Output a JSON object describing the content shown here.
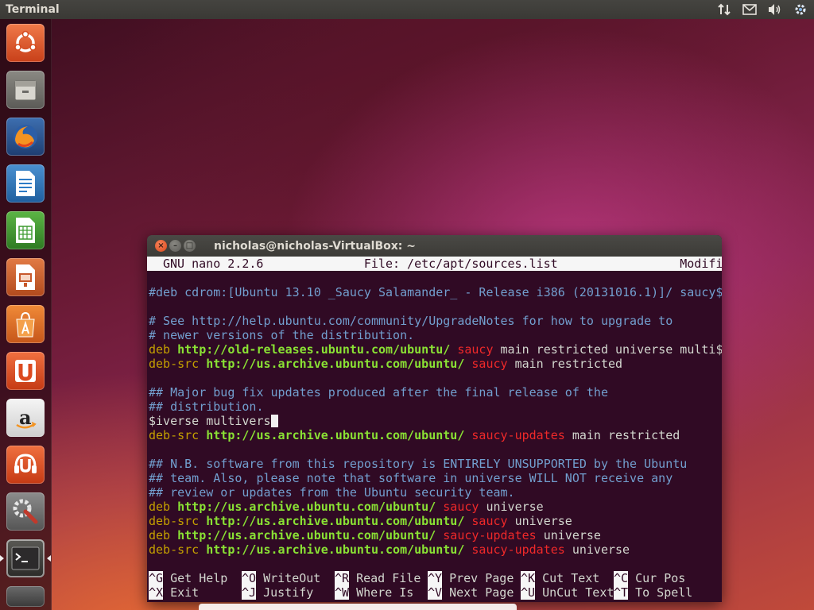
{
  "top_panel": {
    "title": "Terminal"
  },
  "launcher": {
    "items": [
      {
        "name": "ubuntu-dash-icon",
        "color": "#e8542a"
      },
      {
        "name": "files-icon",
        "color": "#a8a79f"
      },
      {
        "name": "firefox-icon",
        "color": "#2b5ea7"
      },
      {
        "name": "writer-icon",
        "color": "#2d7bc6"
      },
      {
        "name": "calc-icon",
        "color": "#3c9a2e"
      },
      {
        "name": "impress-icon",
        "color": "#c7582b"
      },
      {
        "name": "software-center-icon",
        "color": "#e07a2a"
      },
      {
        "name": "ubuntu-one-icon",
        "color": "#dc4a1f"
      },
      {
        "name": "amazon-icon",
        "color": "#e8e8e8"
      },
      {
        "name": "ubuntu-one-music-icon",
        "color": "#dc4a1f"
      },
      {
        "name": "system-settings-icon",
        "color": "#7a7a7a"
      },
      {
        "name": "terminal-icon",
        "color": "#3c3b37"
      }
    ]
  },
  "window": {
    "title": "nicholas@nicholas-VirtualBox: ~"
  },
  "nano": {
    "version": "GNU nano 2.2.6",
    "file": "File: /etc/apt/sources.list",
    "status": "Modified",
    "lines": [
      [
        {
          "t": "",
          "c": "plain"
        }
      ],
      [
        {
          "t": "#deb cdrom:[Ubuntu 13.10 _Saucy Salamander_ - Release i386 (20131016.1)]/ saucy$",
          "c": "com"
        }
      ],
      [
        {
          "t": "",
          "c": "plain"
        }
      ],
      [
        {
          "t": "# See http://help.ubuntu.com/community/UpgradeNotes for how to upgrade to",
          "c": "com"
        }
      ],
      [
        {
          "t": "# newer versions of the distribution.",
          "c": "com"
        }
      ],
      [
        {
          "t": "deb ",
          "c": "deb"
        },
        {
          "t": "http://old-releases.ubuntu.com/ubuntu/",
          "c": "url"
        },
        {
          "t": " saucy",
          "c": "red"
        },
        {
          "t": " main restricted universe multi$",
          "c": "rest"
        }
      ],
      [
        {
          "t": "deb-src ",
          "c": "deb"
        },
        {
          "t": "http://us.archive.ubuntu.com/ubuntu/",
          "c": "url"
        },
        {
          "t": " saucy",
          "c": "red"
        },
        {
          "t": " main restricted",
          "c": "rest"
        }
      ],
      [
        {
          "t": "",
          "c": "plain"
        }
      ],
      [
        {
          "t": "## Major bug fix updates produced after the final release of the",
          "c": "com"
        }
      ],
      [
        {
          "t": "## distribution.",
          "c": "com"
        }
      ],
      [
        {
          "t": "$iverse multivers",
          "c": "plain"
        },
        {
          "t": "",
          "c": "cursor"
        }
      ],
      [
        {
          "t": "deb-src ",
          "c": "deb"
        },
        {
          "t": "http://us.archive.ubuntu.com/ubuntu/",
          "c": "url"
        },
        {
          "t": " saucy-updates",
          "c": "red"
        },
        {
          "t": " main restricted",
          "c": "rest"
        }
      ],
      [
        {
          "t": "",
          "c": "plain"
        }
      ],
      [
        {
          "t": "## N.B. software from this repository is ENTIRELY UNSUPPORTED by the Ubuntu",
          "c": "com"
        }
      ],
      [
        {
          "t": "## team. Also, please note that software in universe WILL NOT receive any",
          "c": "com"
        }
      ],
      [
        {
          "t": "## review or updates from the Ubuntu security team.",
          "c": "com"
        }
      ],
      [
        {
          "t": "deb ",
          "c": "deb"
        },
        {
          "t": "http://us.archive.ubuntu.com/ubuntu/",
          "c": "url"
        },
        {
          "t": " saucy",
          "c": "red"
        },
        {
          "t": " universe",
          "c": "rest"
        }
      ],
      [
        {
          "t": "deb-src ",
          "c": "deb"
        },
        {
          "t": "http://us.archive.ubuntu.com/ubuntu/",
          "c": "url"
        },
        {
          "t": " saucy",
          "c": "red"
        },
        {
          "t": " universe",
          "c": "rest"
        }
      ],
      [
        {
          "t": "deb ",
          "c": "deb"
        },
        {
          "t": "http://us.archive.ubuntu.com/ubuntu/",
          "c": "url"
        },
        {
          "t": " saucy-updates",
          "c": "red"
        },
        {
          "t": " universe",
          "c": "rest"
        }
      ],
      [
        {
          "t": "deb-src ",
          "c": "deb"
        },
        {
          "t": "http://us.archive.ubuntu.com/ubuntu/",
          "c": "url"
        },
        {
          "t": " saucy-updates",
          "c": "red"
        },
        {
          "t": " universe",
          "c": "rest"
        }
      ]
    ],
    "shortcuts_row1": [
      {
        "key": "^G",
        "label": "Get Help"
      },
      {
        "key": "^O",
        "label": "WriteOut"
      },
      {
        "key": "^R",
        "label": "Read File"
      },
      {
        "key": "^Y",
        "label": "Prev Page"
      },
      {
        "key": "^K",
        "label": "Cut Text"
      },
      {
        "key": "^C",
        "label": "Cur Pos"
      }
    ],
    "shortcuts_row2": [
      {
        "key": "^X",
        "label": "Exit"
      },
      {
        "key": "^J",
        "label": "Justify"
      },
      {
        "key": "^W",
        "label": "Where Is"
      },
      {
        "key": "^V",
        "label": "Next Page"
      },
      {
        "key": "^U",
        "label": "UnCut Text"
      },
      {
        "key": "^T",
        "label": "To Spell"
      }
    ]
  },
  "colors": {
    "terminal_bg": "#300a24",
    "comment": "#729fcf",
    "keyword": "#c4a000",
    "url": "#8ae234",
    "suite": "#ef2929"
  }
}
